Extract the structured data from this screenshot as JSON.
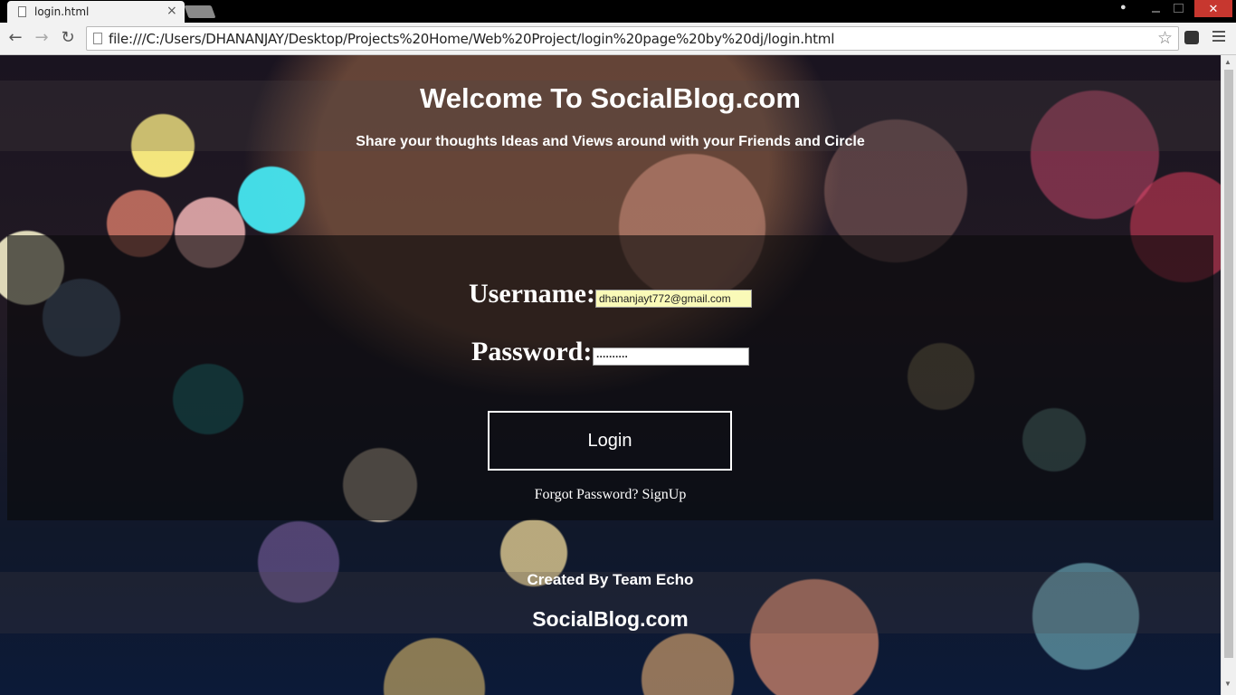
{
  "browser": {
    "tab_title": "login.html",
    "tab_close": "×",
    "url": "file:///C:/Users/DHANANJAY/Desktop/Projects%20Home/Web%20Project/login%20page%20by%20dj/login.html",
    "close_window": "✕"
  },
  "header": {
    "title": "Welcome To SocialBlog.com",
    "subtitle": "Share your thoughts Ideas and Views around with your Friends and Circle"
  },
  "login": {
    "username_label": "Username:",
    "username_value": "dhananjayt772@gmail.com",
    "password_label": "Password:",
    "password_value": "··········",
    "button_label": "Login",
    "forgot_link": "Forgot Password?",
    "signup_link": "SignUp"
  },
  "footer": {
    "credit": "Created By Team Echo",
    "brand": "SocialBlog.com"
  },
  "icons": [
    "page-icon",
    "back-arrow-icon",
    "forward-arrow-icon",
    "reload-icon",
    "star-icon",
    "extension-icon",
    "menu-icon",
    "user-icon"
  ]
}
